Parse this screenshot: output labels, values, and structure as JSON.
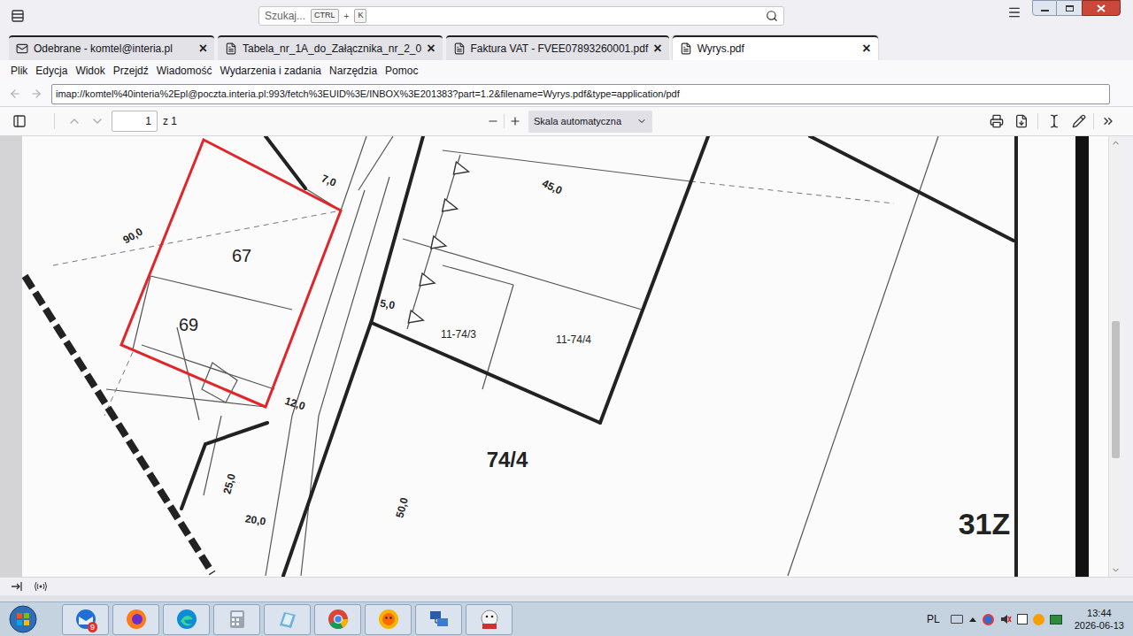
{
  "window": {
    "search_placeholder": "Szukaj...",
    "shortcut": [
      "CTRL",
      "+",
      "K"
    ]
  },
  "tabs": [
    {
      "label": "Odebrane - komtel@interia.pl",
      "kind": "mail",
      "selected": false
    },
    {
      "label": "Tabela_nr_1A_do_Załącznika_nr_2_0",
      "kind": "document",
      "selected": false
    },
    {
      "label": "Faktura VAT - FVEE07893260001.pdf",
      "kind": "document",
      "selected": false
    },
    {
      "label": "Wyrys.pdf",
      "kind": "document",
      "selected": true
    }
  ],
  "tab_close": "×",
  "menu": [
    "Plik",
    "Edycja",
    "Widok",
    "Przejdź",
    "Wiadomość",
    "Wydarzenia i zadania",
    "Narzędzia",
    "Pomoc"
  ],
  "address": "imap://komtel%40interia%2Epl@poczta.interia.pl:993/fetch%3EUID%3E/INBOX%3E201383?part=1.2&filename=Wyrys.pdf&type=application/pdf",
  "pdf_toolbar": {
    "page": "1",
    "page_count": "z 1",
    "zoom": "Skala automatyczna"
  },
  "map": {
    "labels": [
      {
        "text": "67"
      },
      {
        "text": "69"
      },
      {
        "text": "7,0"
      },
      {
        "text": "45,0"
      },
      {
        "text": "90,0"
      },
      {
        "text": "5,0"
      },
      {
        "text": "11-74/3"
      },
      {
        "text": "11-74/4"
      },
      {
        "text": "74/4"
      },
      {
        "text": "12,0"
      },
      {
        "text": "25,0"
      },
      {
        "text": "20,0"
      },
      {
        "text": "50,0"
      },
      {
        "text": "31Z"
      }
    ]
  },
  "scrollbar": {
    "position": 0.42,
    "size": 0.31
  },
  "taskbar": {
    "apps": [
      {
        "kind": "thunderbird",
        "badge": "9"
      },
      {
        "kind": "firefox",
        "badge": ""
      },
      {
        "kind": "edge",
        "badge": ""
      },
      {
        "kind": "calculator",
        "badge": ""
      },
      {
        "kind": "notes",
        "badge": ""
      },
      {
        "kind": "chrome",
        "badge": ""
      },
      {
        "kind": "sun",
        "badge": ""
      },
      {
        "kind": "network",
        "badge": ""
      },
      {
        "kind": "pdf24",
        "badge": ""
      }
    ]
  },
  "tray": {
    "language": "PL",
    "time": "13:44",
    "date": "2026-06-13"
  }
}
